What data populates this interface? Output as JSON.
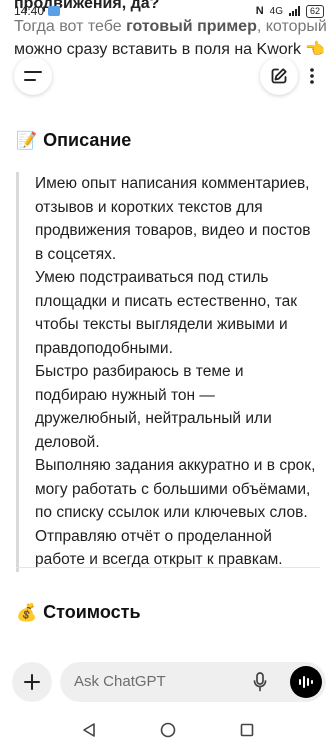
{
  "background_message": {
    "line1": "продвижения, да?",
    "line2_prefix": "Тогда вот тебе ",
    "line2_bold": "готовый пример",
    "line2_suffix": ", который",
    "line3": "можно сразу вставить в поля на Kwork 👈"
  },
  "status_bar": {
    "time": "14:40",
    "network": "4G",
    "battery": "62"
  },
  "description": {
    "emoji": "📝",
    "heading": "Описание",
    "paragraphs": [
      "Имею опыт написания комментариев, отзывов и коротких текстов для продвижения товаров, видео и постов в соцсетях.",
      "Умею подстраиваться под стиль площадки и писать естественно, так чтобы тексты выглядели живыми и правдоподобными.",
      "Быстро разбираюсь в теме и подбираю нужный тон — дружелюбный, нейтральный или деловой.",
      "Выполняю задания аккуратно и в срок, могу работать с большими объёмами, по списку ссылок или ключевых слов.",
      "Отправляю отчёт о проделанной работе и всегда открыт к правкам."
    ]
  },
  "cost": {
    "emoji": "💰",
    "heading": "Стоимость"
  },
  "composer": {
    "placeholder": "Ask ChatGPT"
  },
  "colors": {
    "pill_bg": "#efefef",
    "quote_bar": "#d9d9d9",
    "voice_button": "#000000"
  }
}
